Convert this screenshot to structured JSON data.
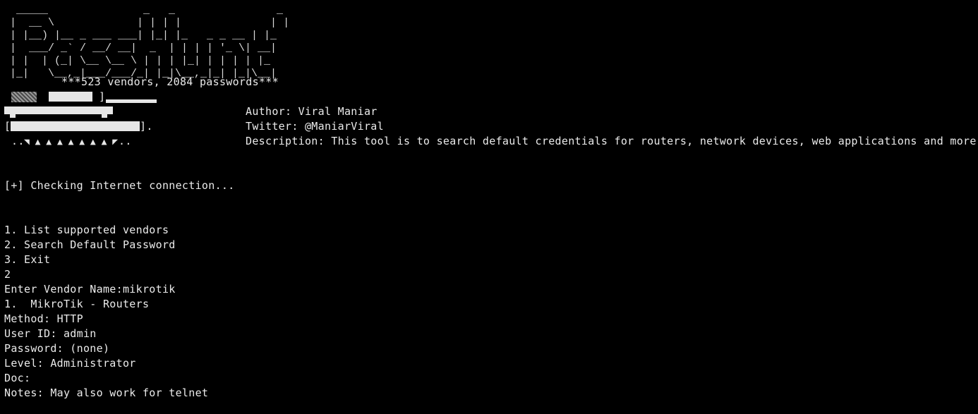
{
  "banner": {
    "ascii_art": " _____               _   _                _    \n|  __ \\             | | | |              | |   \n| |__) |__ _ ___ ___| |_| |_   _ _ __ | |_  \n|  ___/ _` / __/ __|  _  | | | | '_ \\| __| \n| |  | (_| \\__ \\__ \\ | | | |_| | | | | |_  \n|_|   \\__,_|___/___/_| |_|\\__,_|_| |_|\\__| ",
    "stats": "***523 vendors, 2084 passwords***"
  },
  "info": {
    "author": "Author: Viral Maniar",
    "twitter": "Twitter: @ManiarViral",
    "description": "Description: This tool is to search default credentials for routers, network devices, web applications and more."
  },
  "decor": {
    "bracket_close": "]",
    "bracket_open": "[",
    "bracket_end": "].",
    "dots_left": "..",
    "dots_right": ".."
  },
  "status": {
    "checking": "[+] Checking Internet connection..."
  },
  "menu": {
    "items": [
      "1. List supported vendors",
      "2. Search Default Password",
      "3. Exit"
    ]
  },
  "session": {
    "choice": "2",
    "vendor_prompt": "Enter Vendor Name:mikrotik",
    "result_title": "1.  MikroTik - Routers",
    "method": "Method: HTTP",
    "user_id": "User ID: admin",
    "password": "Password: (none)",
    "level": "Level: Administrator",
    "doc": "Doc:",
    "notes": "Notes: May also work for telnet"
  },
  "colors": {
    "background": "#000000",
    "text": "#ebebeb"
  }
}
